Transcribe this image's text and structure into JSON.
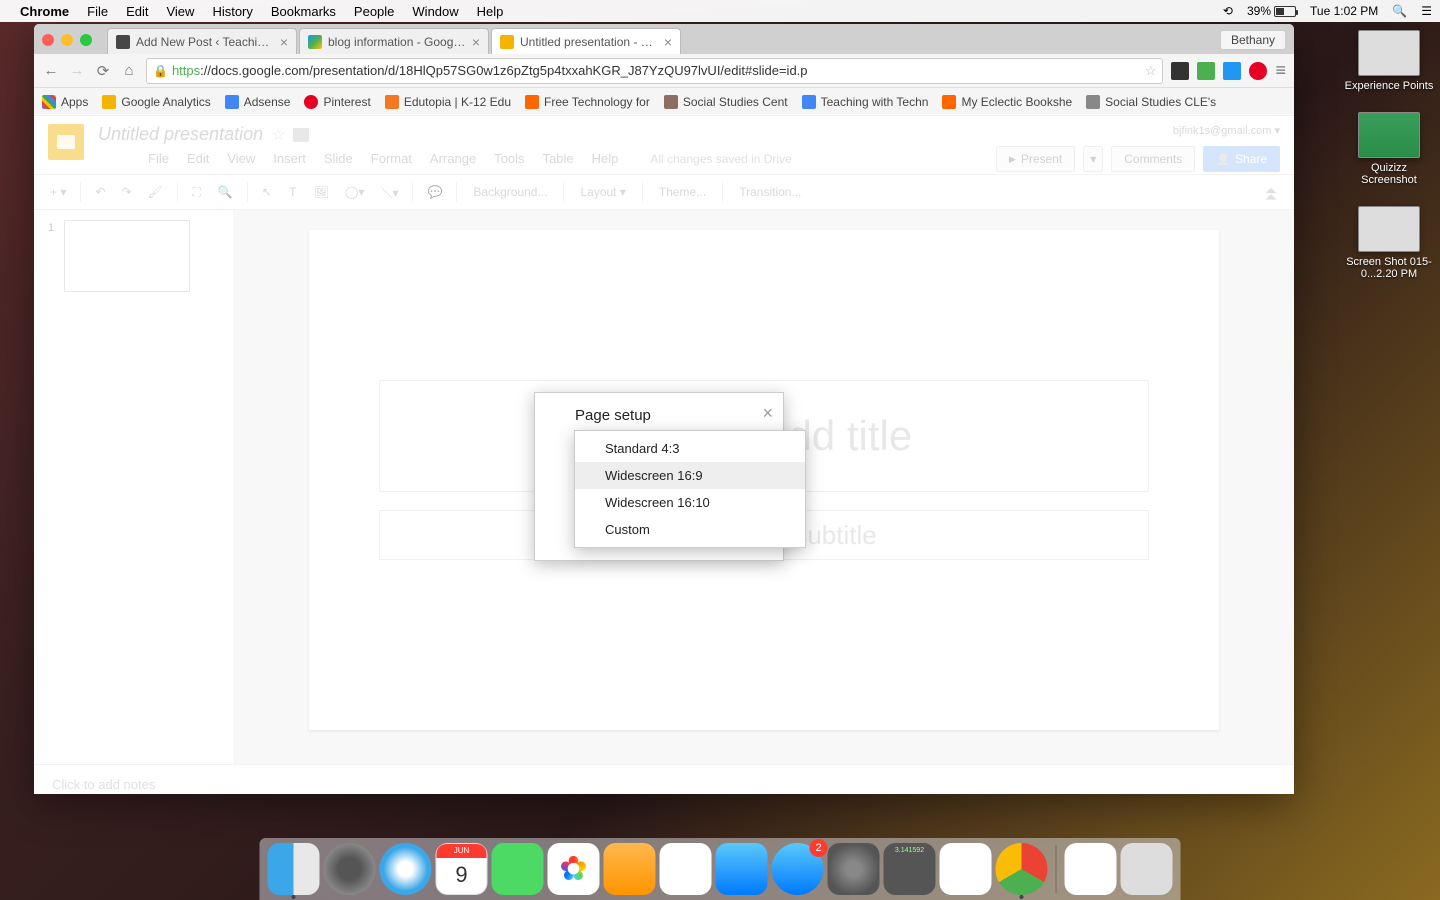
{
  "menubar": {
    "app": "Chrome",
    "items": [
      "File",
      "Edit",
      "View",
      "History",
      "Bookmarks",
      "People",
      "Window",
      "Help"
    ],
    "battery_pct": "39%",
    "clock": "Tue 1:02 PM"
  },
  "desktop": [
    {
      "label": "Experience Points"
    },
    {
      "label": "Quizizz Screenshot"
    },
    {
      "label": "Screen Shot 015-0...2.20 PM"
    }
  ],
  "chrome": {
    "tabs": [
      {
        "title": "Add New Post ‹ Teaching w"
      },
      {
        "title": "blog information - Google D"
      },
      {
        "title": "Untitled presentation - Goo"
      }
    ],
    "user_chip": "Bethany",
    "url_https": "https",
    "url_rest": "://docs.google.com/presentation/d/18HlQp57SG0w1z6pZtg5p4txxahKGR_J87YzQU97lvUI/edit#slide=id.p",
    "bookmarks": [
      {
        "label": "Apps"
      },
      {
        "label": "Google Analytics"
      },
      {
        "label": "Adsense"
      },
      {
        "label": "Pinterest"
      },
      {
        "label": "Edutopia | K-12 Edu"
      },
      {
        "label": "Free Technology for"
      },
      {
        "label": "Social Studies Cent"
      },
      {
        "label": "Teaching with Techn"
      },
      {
        "label": "My Eclectic Bookshe"
      },
      {
        "label": "Social Studies CLE's"
      }
    ]
  },
  "slides": {
    "doc_title": "Untitled presentation",
    "user_email": "bjfink1s@gmail.com",
    "menus": [
      "File",
      "Edit",
      "View",
      "Insert",
      "Slide",
      "Format",
      "Arrange",
      "Tools",
      "Table",
      "Help"
    ],
    "saved_msg": "All changes saved in Drive",
    "btn_present": "Present",
    "btn_comments": "Comments",
    "btn_share": "Share",
    "toolbar_text": [
      "Background...",
      "Layout",
      "Theme...",
      "Transition..."
    ],
    "slide_number": "1",
    "title_placeholder": "Click to add title",
    "subtitle_placeholder": "Click to add subtitle",
    "notes_placeholder": "Click to add notes"
  },
  "dialog": {
    "title": "Page setup",
    "options": [
      "Standard 4:3",
      "Widescreen 16:9",
      "Widescreen 16:10",
      "Custom"
    ],
    "highlighted_index": 1
  },
  "dock": {
    "cal_month": "JUN",
    "cal_day": "9",
    "appstore_badge": "2",
    "calc_display": "3.141592"
  }
}
